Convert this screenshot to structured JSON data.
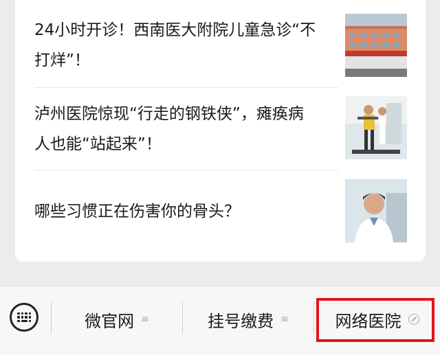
{
  "articles": [
    {
      "title_line1": "24小时开诊！西南医大附院儿童急诊“不",
      "title_line2": "打烊”！",
      "thumbnail": "hospital-building-image"
    },
    {
      "title_line1": "泸州医院惊现“行走的钢铁侠”，瘫痪病",
      "title_line2": "人也能“站起来”！",
      "thumbnail": "rehab-exoskeleton-image"
    },
    {
      "title_line1": "哪些习惯正在伤害你的骨头？",
      "title_line2": "",
      "thumbnail": "doctor-portrait-image"
    }
  ],
  "menu": {
    "keyboard_icon": "keyboard-icon",
    "items": [
      {
        "label": "微官网",
        "suffix": "≡"
      },
      {
        "label": "挂号缴费",
        "suffix": "≡"
      },
      {
        "label": "网络医院",
        "icon": "link-icon"
      }
    ]
  },
  "colors": {
    "highlight": "#e0141e",
    "background": "#ececec",
    "card": "#ffffff"
  }
}
